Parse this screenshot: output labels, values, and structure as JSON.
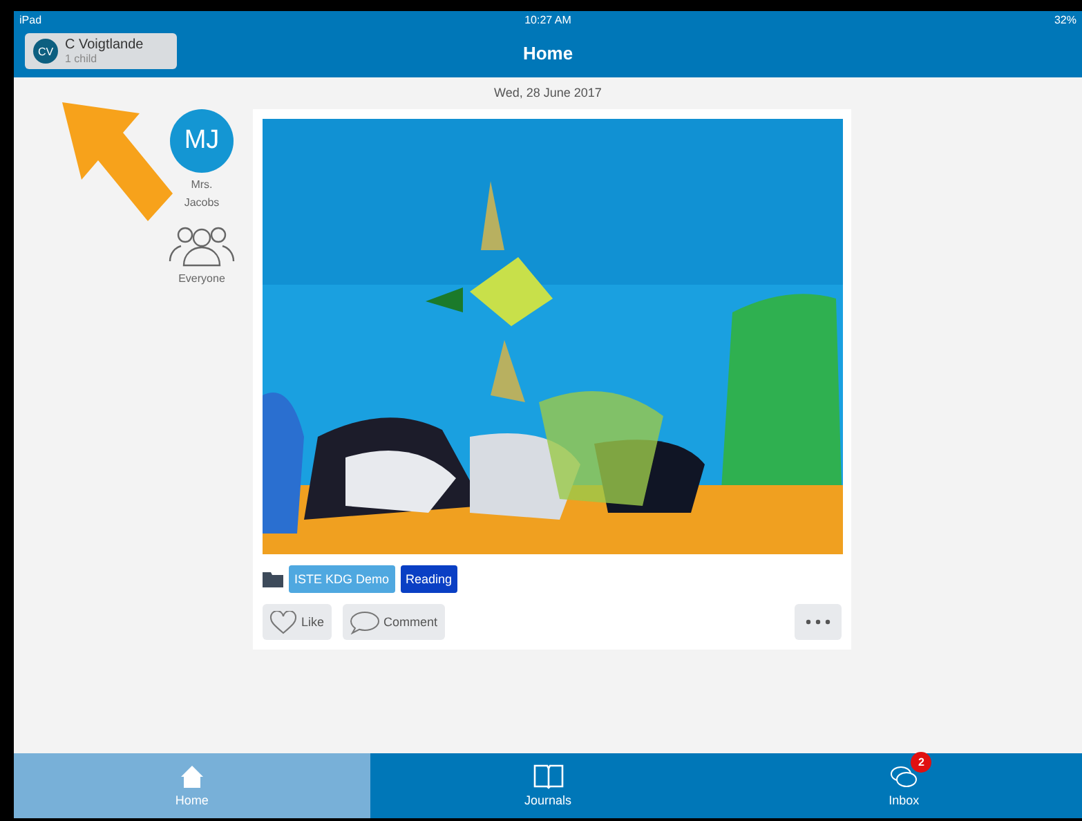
{
  "status_bar": {
    "device": "iPad",
    "time": "10:27 AM",
    "battery": "32%"
  },
  "header": {
    "title": "Home",
    "account": {
      "initials": "CV",
      "name": "C Voigtlande",
      "subtitle": "1 child"
    }
  },
  "date": "Wed, 28 June 2017",
  "post": {
    "author": {
      "initials": "MJ",
      "name": "Mrs. Jacobs"
    },
    "audience": "Everyone",
    "tags": [
      {
        "label": "ISTE KDG Demo",
        "color": "#4fa8e0"
      },
      {
        "label": "Reading",
        "color": "#0a3fc4"
      }
    ],
    "actions": [
      {
        "kind": "like",
        "label": "Like"
      },
      {
        "kind": "comment",
        "label": "Comment"
      },
      {
        "kind": "more"
      }
    ]
  },
  "tab_bar": [
    {
      "kind": "home",
      "label": "Home",
      "selected": true
    },
    {
      "kind": "journals",
      "label": "Journals",
      "selected": false
    },
    {
      "kind": "inbox",
      "label": "Inbox",
      "selected": false,
      "badge": "2"
    }
  ]
}
